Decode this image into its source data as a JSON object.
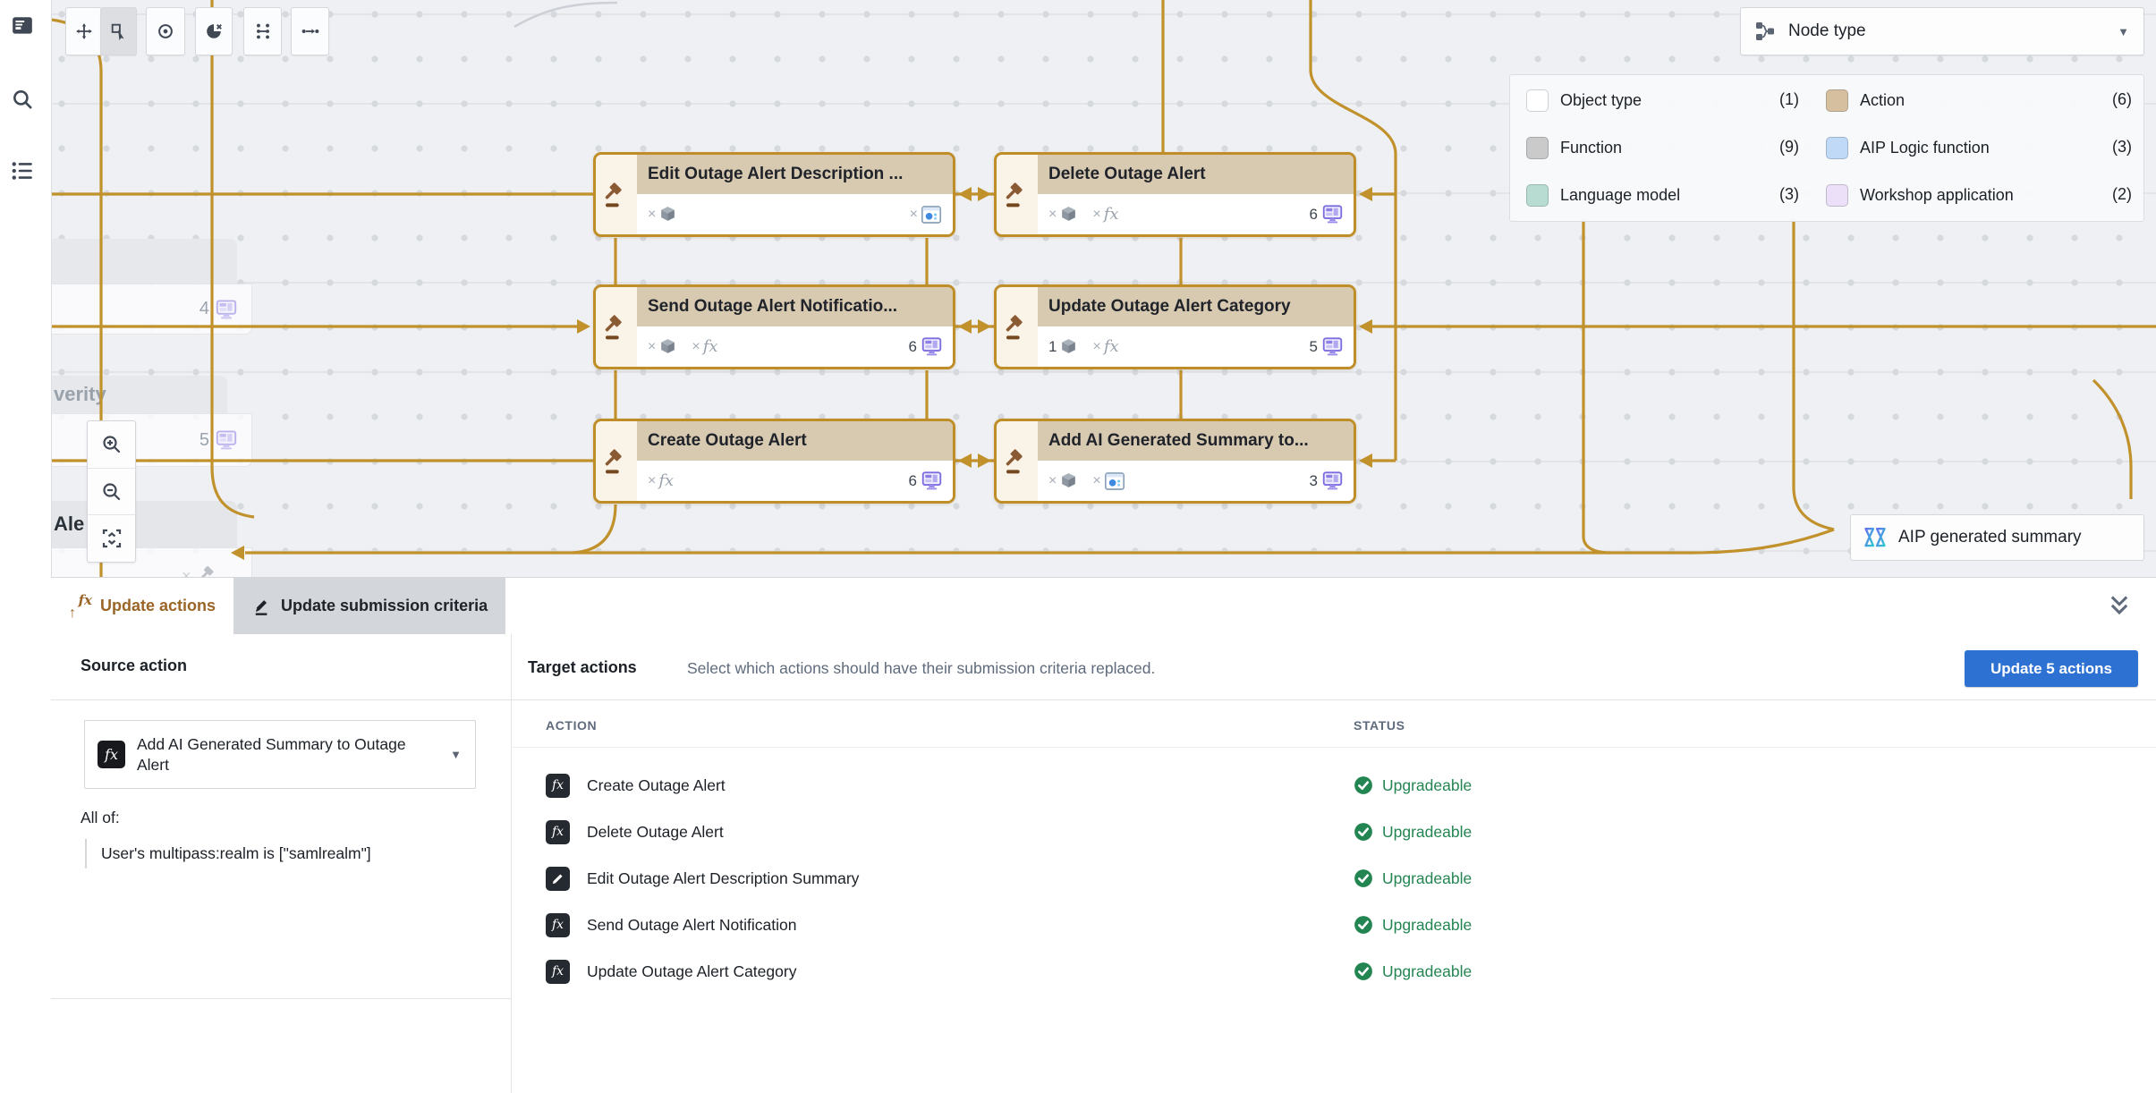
{
  "glyphs": {
    "x": "×",
    "fx": "fx",
    "caret": "▼",
    "up": "↑"
  },
  "node_type_filter": {
    "label": "Node type"
  },
  "legend": {
    "items": [
      {
        "label": "Object type",
        "count": "(1)",
        "color": "#ffffff"
      },
      {
        "label": "Action",
        "count": "(6)",
        "color": "#d5bf9e"
      },
      {
        "label": "Function",
        "count": "(9)",
        "color": "#cacaca"
      },
      {
        "label": "AIP Logic function",
        "count": "(3)",
        "color": "#bfd9f6"
      },
      {
        "label": "Language model",
        "count": "(3)",
        "color": "#b9dcd2"
      },
      {
        "label": "Workshop application",
        "count": "(2)",
        "color": "#ecdff8"
      }
    ]
  },
  "canvas": {
    "nodes": [
      {
        "title": "Edit Outage Alert Description ..."
      },
      {
        "title": "Delete Outage Alert",
        "count": "6"
      },
      {
        "title": "Send Outage Alert Notificatio...",
        "count": "6"
      },
      {
        "title": "Update Outage Alert Category",
        "object_count": "1",
        "count": "5"
      },
      {
        "title": "Create Outage Alert",
        "count": "6"
      },
      {
        "title": "Add AI Generated Summary to...",
        "count": "3"
      }
    ],
    "ghost": {
      "count_a": "4",
      "count_b": "5",
      "label_b": "verity",
      "label_c": "Ale"
    },
    "aip_chip_label": "AIP generated summary"
  },
  "panel": {
    "tabs": [
      {
        "label": "Update actions"
      },
      {
        "label": "Update submission criteria"
      }
    ],
    "source": {
      "heading": "Source action",
      "selected": "Add AI Generated Summary to Outage Alert",
      "all_of": "All of:",
      "criteria": "User's multipass:realm is [\"samlrealm\"]"
    },
    "target": {
      "heading": "Target actions",
      "subtitle": "Select which actions should have their submission criteria replaced.",
      "button_label": "Update 5 actions",
      "columns": [
        "ACTION",
        "STATUS"
      ],
      "rows": [
        {
          "icon": "fx",
          "action": "Create Outage Alert",
          "status": "Upgradeable"
        },
        {
          "icon": "fx",
          "action": "Delete Outage Alert",
          "status": "Upgradeable"
        },
        {
          "icon": "pencil",
          "action": "Edit Outage Alert Description Summary",
          "status": "Upgradeable"
        },
        {
          "icon": "fx",
          "action": "Send Outage Alert Notification",
          "status": "Upgradeable"
        },
        {
          "icon": "fx",
          "action": "Update Outage Alert Category",
          "status": "Upgradeable"
        }
      ]
    }
  }
}
